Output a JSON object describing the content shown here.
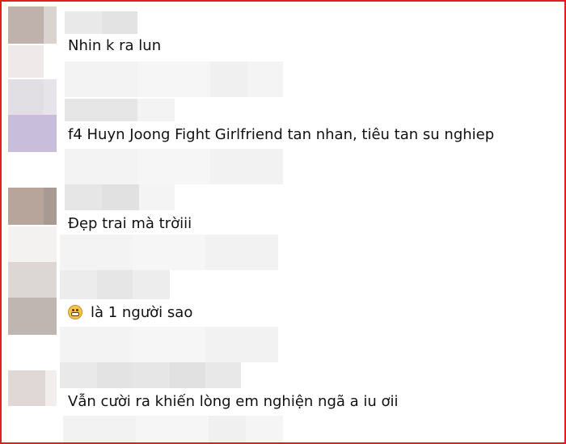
{
  "comments": [
    {
      "text": "Nhin k ra lun"
    },
    {
      "text": "f4 Huyn Joong Fight Girlfriend tan nhan, tiêu tan su nghiep"
    },
    {
      "text": "Đẹp trai mà trờiii"
    },
    {
      "emoji": "grimacing-face-icon",
      "text": "là 1 người sao"
    },
    {
      "text": "Vẫn cười ra khiến lòng em nghiện ngã a iu ơii"
    }
  ],
  "colors": {
    "border": "#e02020",
    "text": "#111111",
    "blur_light": "#f2f2f2",
    "blur_mid": "#e8e8e8",
    "avatar_purple": "#c9bddc"
  }
}
